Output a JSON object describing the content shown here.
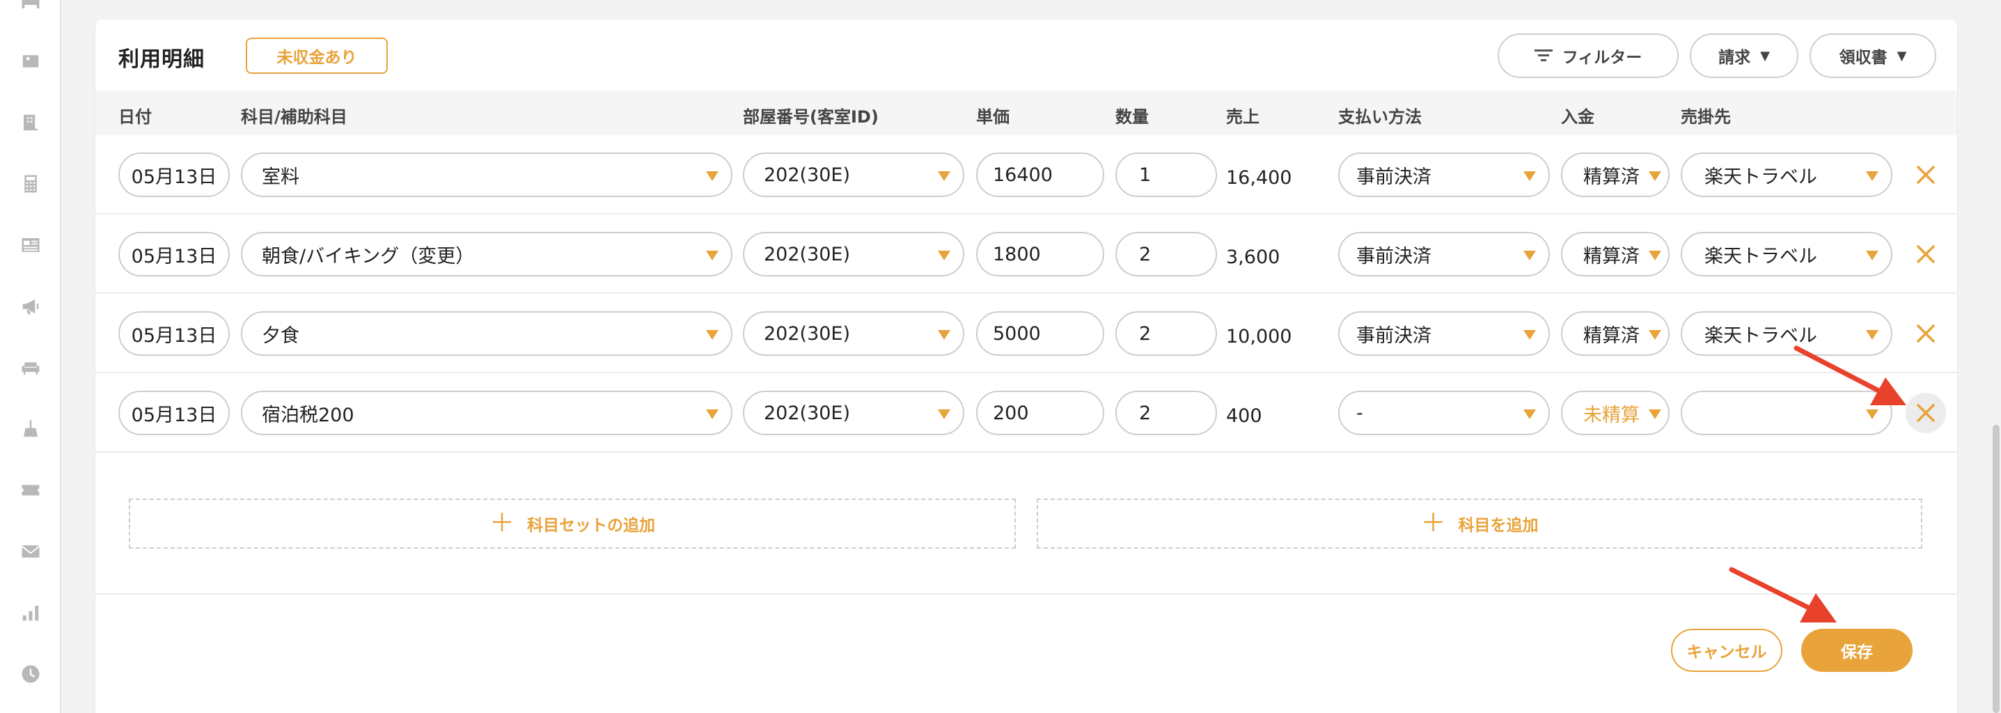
{
  "panel": {
    "title": "利用明細",
    "unpaid_badge": "未収金あり",
    "filter_label": "フィルター",
    "invoice_label": "請求",
    "receipt_label": "領収書"
  },
  "columns": {
    "date": "日付",
    "item": "科目/補助科目",
    "room": "部屋番号(客室ID)",
    "unit_price": "単価",
    "quantity": "数量",
    "sales": "売上",
    "payment_method": "支払い方法",
    "deposit": "入金",
    "account": "売掛先"
  },
  "rows": [
    {
      "date": "05月13日",
      "item": "室料",
      "room": "202(30E)",
      "unit_price": "16400",
      "quantity": "1",
      "sales": "16,400",
      "payment_method": "事前決済",
      "deposit": "精算済",
      "account": "楽天トラベル"
    },
    {
      "date": "05月13日",
      "item": "朝食/バイキング（変更）",
      "room": "202(30E)",
      "unit_price": "1800",
      "quantity": "2",
      "sales": "3,600",
      "payment_method": "事前決済",
      "deposit": "精算済",
      "account": "楽天トラベル"
    },
    {
      "date": "05月13日",
      "item": "夕食",
      "room": "202(30E)",
      "unit_price": "5000",
      "quantity": "2",
      "sales": "10,000",
      "payment_method": "事前決済",
      "deposit": "精算済",
      "account": "楽天トラベル"
    },
    {
      "date": "05月13日",
      "item": "宿泊税200",
      "room": "202(30E)",
      "unit_price": "200",
      "quantity": "2",
      "sales": "400",
      "payment_method": "-",
      "deposit": "未精算",
      "account": ""
    }
  ],
  "actions": {
    "add_item_set": "科目セットの追加",
    "add_item": "科目を追加",
    "cancel": "キャンセル",
    "save": "保存"
  },
  "colors": {
    "accent": "#e8a33a",
    "annotation_arrow": "#e8412c"
  }
}
